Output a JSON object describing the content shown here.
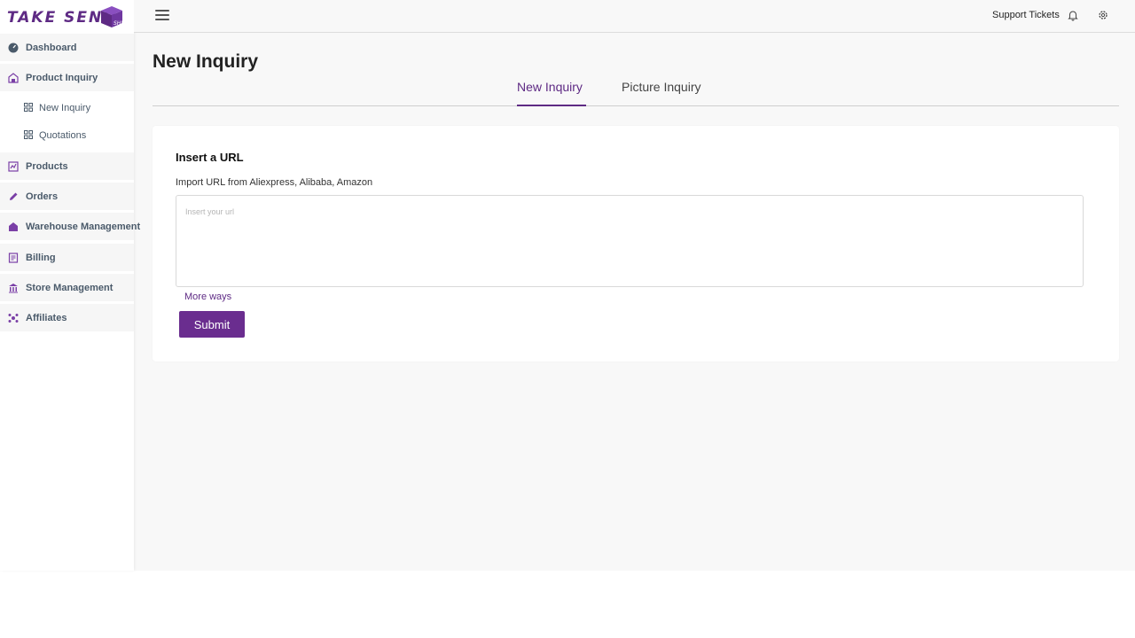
{
  "brand": {
    "logo_text": "TAKE SEND",
    "logo_badge": "SHIP",
    "accent_color": "#6a2d8f"
  },
  "sidebar": {
    "items": [
      {
        "label": "Dashboard",
        "icon": "dashboard-icon"
      },
      {
        "label": "Product Inquiry",
        "icon": "inquiry-icon",
        "children": [
          {
            "label": "New Inquiry",
            "icon": "grid-icon"
          },
          {
            "label": "Quotations",
            "icon": "grid-icon"
          }
        ]
      },
      {
        "label": "Products",
        "icon": "products-icon"
      },
      {
        "label": "Orders",
        "icon": "pencil-icon"
      },
      {
        "label": "Warehouse Management",
        "icon": "warehouse-icon"
      },
      {
        "label": "Billing",
        "icon": "billing-icon"
      },
      {
        "label": "Store Management",
        "icon": "store-icon"
      },
      {
        "label": "Affiliates",
        "icon": "affiliates-icon"
      }
    ]
  },
  "topbar": {
    "support_label": "Support Tickets"
  },
  "main": {
    "title": "New Inquiry",
    "tabs": [
      {
        "label": "New Inquiry",
        "active": true
      },
      {
        "label": "Picture Inquiry",
        "active": false
      }
    ],
    "card": {
      "title": "Insert a URL",
      "help": "Import URL from Aliexpress, Alibaba, Amazon",
      "placeholder": "Insert your url",
      "value": "",
      "more_ways": "More ways",
      "submit": "Submit"
    }
  }
}
